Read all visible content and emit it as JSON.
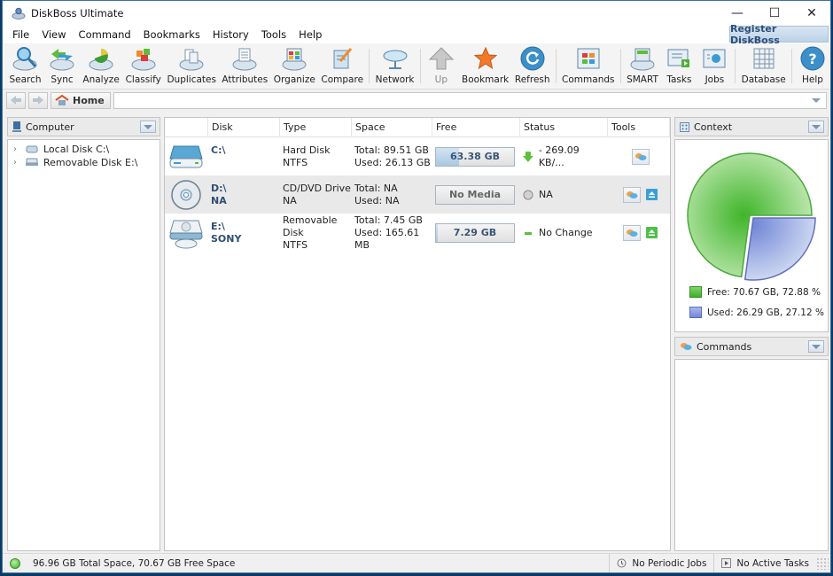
{
  "window": {
    "title": "DiskBoss Ultimate",
    "controls": {
      "minimize": "—",
      "maximize": "☐",
      "close": "✕"
    }
  },
  "menubar": {
    "items": [
      "File",
      "View",
      "Command",
      "Bookmarks",
      "History",
      "Tools",
      "Help"
    ],
    "register_label": "Register DiskBoss"
  },
  "toolbar": {
    "buttons": [
      {
        "label": "Search",
        "icon": "search-icon"
      },
      {
        "label": "Sync",
        "icon": "sync-icon"
      },
      {
        "label": "Analyze",
        "icon": "analyze-icon"
      },
      {
        "label": "Classify",
        "icon": "classify-icon"
      },
      {
        "label": "Duplicates",
        "icon": "duplicates-icon"
      },
      {
        "label": "Attributes",
        "icon": "attributes-icon"
      },
      {
        "label": "Organize",
        "icon": "organize-icon"
      },
      {
        "label": "Compare",
        "icon": "compare-icon"
      },
      {
        "label": "Network",
        "icon": "network-icon"
      },
      {
        "label": "Up",
        "icon": "up-arrow-icon",
        "disabled": true
      },
      {
        "label": "Bookmark",
        "icon": "star-icon"
      },
      {
        "label": "Refresh",
        "icon": "refresh-icon"
      },
      {
        "label": "Commands",
        "icon": "commands-icon"
      },
      {
        "label": "SMART",
        "icon": "smart-icon"
      },
      {
        "label": "Tasks",
        "icon": "tasks-icon"
      },
      {
        "label": "Jobs",
        "icon": "jobs-icon"
      },
      {
        "label": "Database",
        "icon": "database-icon"
      },
      {
        "label": "Help",
        "icon": "help-icon"
      }
    ]
  },
  "navbar": {
    "home_label": "Home",
    "path_value": ""
  },
  "left_panel": {
    "header": "Computer",
    "tree": [
      {
        "label": "Local Disk C:\\"
      },
      {
        "label": "Removable Disk E:\\"
      }
    ]
  },
  "disk_table": {
    "columns": [
      "Disk",
      "Type",
      "Space",
      "Free",
      "Status",
      "Tools"
    ],
    "rows": [
      {
        "disk": "C:\\",
        "label": "",
        "type": "Hard Disk",
        "fs": "NTFS",
        "total": "Total: 89.51 GB",
        "used": "Used: 26.13 GB",
        "free": "63.38 GB",
        "free_fraction": 0.29,
        "status": "- 269.09 KB/...",
        "status_icon": "arrow-down-icon",
        "eject": false
      },
      {
        "disk": "D:\\",
        "label": "NA",
        "type": "CD/DVD Drive",
        "fs": "NA",
        "total": "Total: NA",
        "used": "Used: NA",
        "free": "No Media",
        "free_fraction": 0,
        "status": "NA",
        "status_icon": "neutral-circle-icon",
        "eject": true,
        "eject_color": "#3a9fd6"
      },
      {
        "disk": "E:\\",
        "label": "SONY",
        "type": "Removable Disk",
        "fs": "NTFS",
        "total": "Total: 7.45 GB",
        "used": "Used: 165.61 MB",
        "free": "7.29 GB",
        "free_fraction": 0.02,
        "status": "No Change",
        "status_icon": "dash-icon",
        "eject": true,
        "eject_color": "#4fc04a"
      }
    ]
  },
  "context_panel": {
    "header": "Context",
    "legend": [
      {
        "label": "Free: 70.67 GB, 72.88 %",
        "color": "#5cc44a"
      },
      {
        "label": "Used: 26.29 GB, 27.12 %",
        "color": "#8a9be0"
      }
    ]
  },
  "commands_panel": {
    "header": "Commands"
  },
  "statusbar": {
    "summary": "96.96 GB Total Space, 70.67 GB Free Space",
    "jobs": "No Periodic Jobs",
    "tasks": "No Active Tasks"
  },
  "chart_data": {
    "type": "pie",
    "title": "",
    "categories": [
      "Free",
      "Used"
    ],
    "values": [
      72.88,
      27.12
    ],
    "labels": [
      "Free: 70.67 GB, 72.88 %",
      "Used: 26.29 GB, 27.12 %"
    ],
    "colors": [
      "#5cc44a",
      "#8a9be0"
    ],
    "legend": "bottom"
  }
}
